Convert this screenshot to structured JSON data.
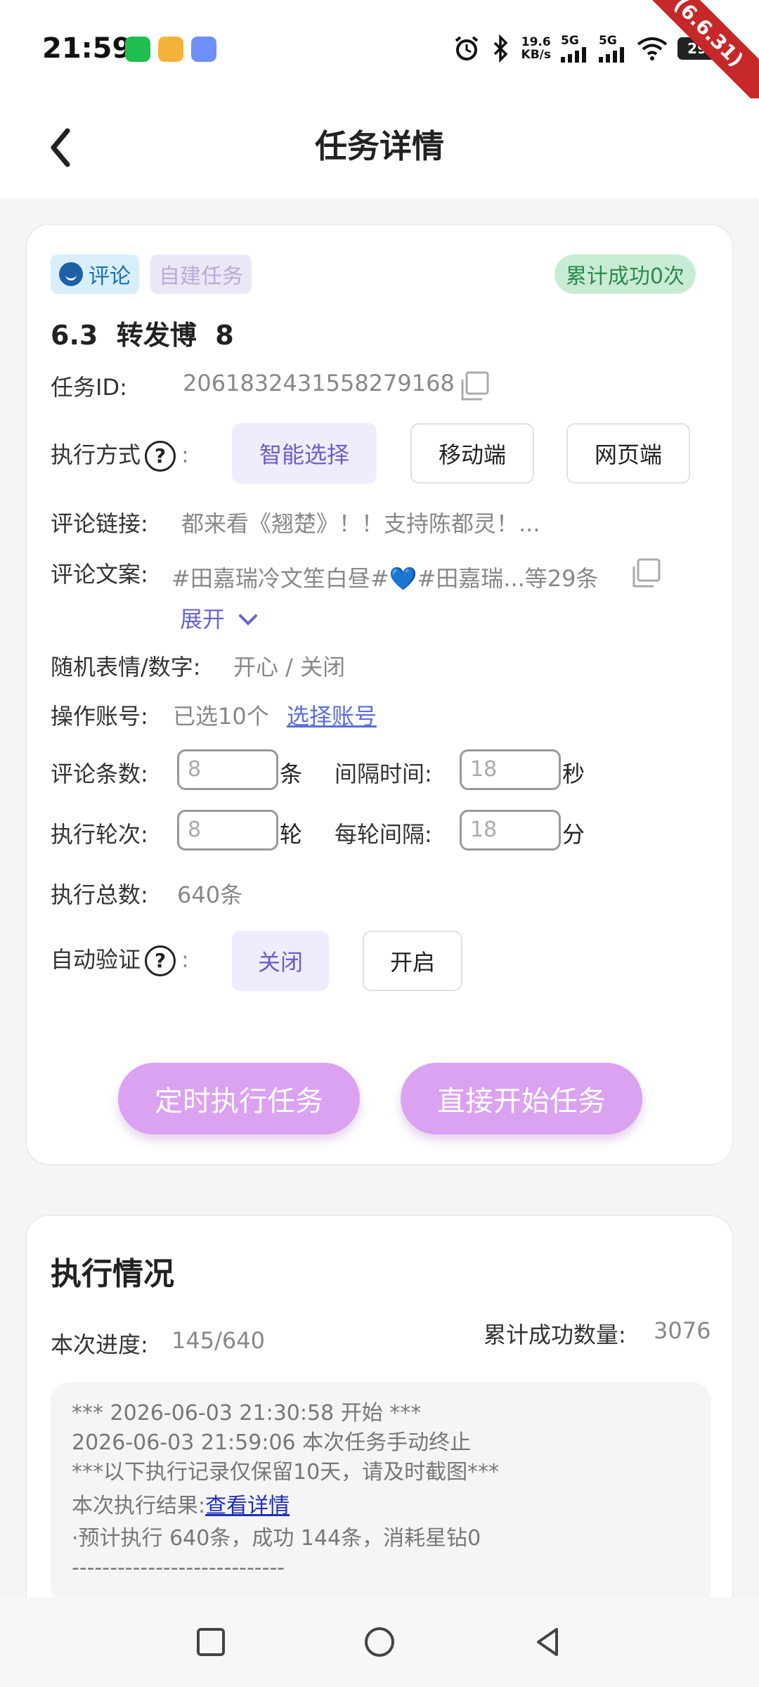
{
  "status_bar": {
    "time": "21:59",
    "net_speed_value": "19.6",
    "net_speed_unit": "KB/s",
    "signal_1": "5G",
    "signal_2": "5G",
    "battery": "29",
    "version_ribbon": "(6.6.31)",
    "icons": [
      "wechat-icon",
      "weibo-icon",
      "app-icon",
      "alarm-icon",
      "bluetooth-icon",
      "signal-icon",
      "wifi-icon",
      "battery-icon"
    ]
  },
  "header": {
    "title": "任务详情",
    "back_icon": "chevron-left-icon"
  },
  "task": {
    "tag_type": "评论",
    "tag_self": "自建任务",
    "tag_success": "累计成功0次",
    "name": "6.3  转发博  8",
    "id_label": "任务ID:",
    "id_value": "2061832431558279168",
    "exec_mode_label": "执行方式",
    "exec_mode_colon": ":",
    "exec_modes": [
      "智能选择",
      "移动端",
      "网页端"
    ],
    "exec_mode_selected": "智能选择",
    "comment_link_label": "评论链接:",
    "comment_link_value": "都来看《翘楚》！！支持陈都灵！...",
    "comment_text_label": "评论文案:",
    "comment_text_value": "#田嘉瑞冷文笙白昼#💙#田嘉瑞...等29条",
    "expand_label": "展开",
    "random_label": "随机表情/数字:",
    "random_value": "开心 / 关闭",
    "account_label": "操作账号:",
    "account_value": "已选10个",
    "account_link": "选择账号",
    "comment_count_label": "评论条数:",
    "comment_count_value": "8",
    "comment_count_unit": "条",
    "interval_label": "间隔时间:",
    "interval_value": "18",
    "interval_unit": "秒",
    "rounds_label": "执行轮次:",
    "rounds_value": "8",
    "rounds_unit": "轮",
    "round_interval_label": "每轮间隔:",
    "round_interval_value": "18",
    "round_interval_unit": "分",
    "total_label": "执行总数:",
    "total_value": "640条",
    "auto_verify_label": "自动验证",
    "auto_verify_colon": ":",
    "auto_verify_options": [
      "关闭",
      "开启"
    ],
    "auto_verify_selected": "关闭",
    "btn_schedule": "定时执行任务",
    "btn_start": "直接开始任务"
  },
  "execution": {
    "title": "执行情况",
    "progress_label": "本次进度:",
    "progress_value": "145/640",
    "progress_fraction": 0.2266,
    "success_label": "累计成功数量:",
    "success_value": "3076",
    "log": {
      "line1": "***  2026-06-03 21:30:58 开始  ***",
      "line2": "2026-06-03 21:59:06 本次任务手动终止",
      "line3": "***以下执行记录仅保留10天，请及时截图***",
      "result_label": "本次执行结果:",
      "result_link": "查看详情",
      "summary": "·预计执行 640条，成功 144条，消耗星钻0",
      "divider": "----------------------------"
    }
  },
  "nav": {
    "icons": [
      "recent-apps-icon",
      "home-icon",
      "back-icon"
    ]
  }
}
